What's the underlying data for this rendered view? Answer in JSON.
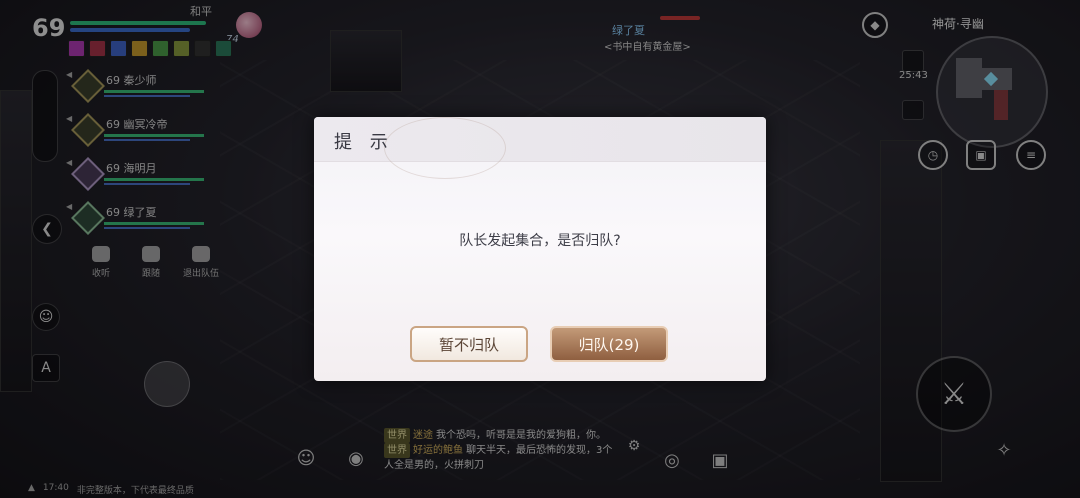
{
  "hud": {
    "player": {
      "level": "69",
      "name": "和平",
      "buff_count": "74"
    },
    "party": [
      {
        "level": "69",
        "name": "秦少师"
      },
      {
        "level": "69",
        "name": "幽冥冷帝"
      },
      {
        "level": "69",
        "name": "海明月"
      },
      {
        "level": "69",
        "name": "绿了夏"
      }
    ],
    "team_actions": [
      {
        "label": "收听",
        "icon": "headphones-icon"
      },
      {
        "label": "跟随",
        "icon": "follow-icon"
      },
      {
        "label": "退出队伍",
        "icon": "exit-team-icon"
      }
    ],
    "ally": {
      "name": "绿了夏",
      "guild": "<书中自有黄金屋>"
    },
    "zone": {
      "name": "神荷·寻幽",
      "time": "25:43"
    },
    "chat": [
      {
        "channel": "世界",
        "name": "迷途",
        "text": "我个恐吗，听哥是是我的爱狗粗，你。"
      },
      {
        "channel": "世界",
        "name": "好运的鲍鱼",
        "text": "聊天半天，最后恐怖的发现，3个人全是男的，火拼刺刀"
      }
    ],
    "status": {
      "time": "17:40",
      "notice": "非完整版本，下代表最终品质"
    }
  },
  "dialog": {
    "title": "提 示",
    "message": "队长发起集合，是否归队?",
    "cancel_label": "暂不归队",
    "confirm_label": "归队(29)"
  }
}
